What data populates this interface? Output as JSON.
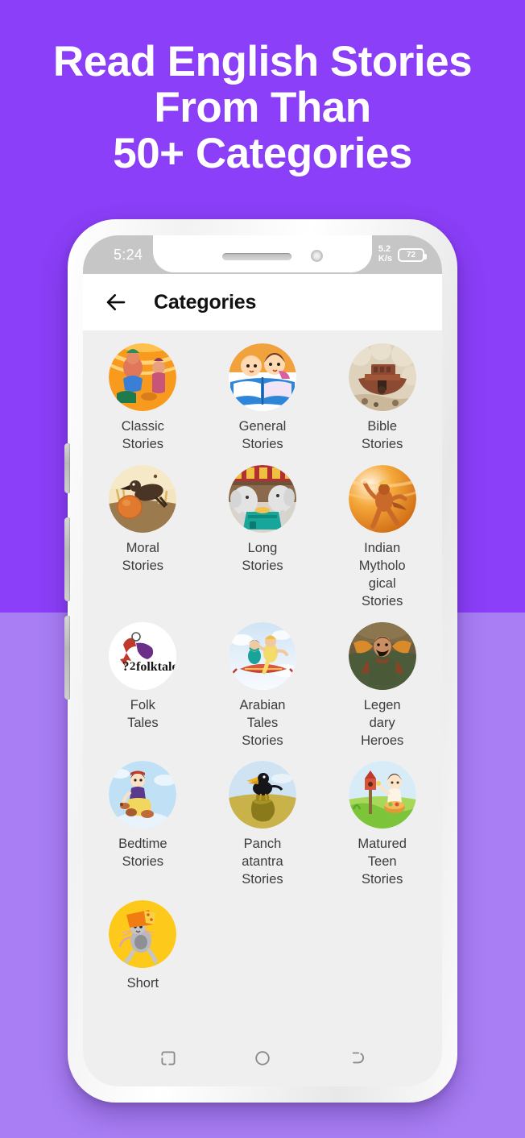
{
  "promo": {
    "line1": "Read English Stories",
    "line2": "From Than",
    "line3": "50+ Categories",
    "bg_color": "#8b3ff8",
    "bg_color_bottom": "#a97ef5",
    "text_color": "#ffffff"
  },
  "statusbar": {
    "time": "5:24",
    "airplane_icon": "airplane-icon",
    "network_speed_value": "5.2",
    "network_speed_unit": "K/s",
    "battery_percent": "72"
  },
  "appbar": {
    "back_icon": "back-arrow-icon",
    "title": "Categories"
  },
  "grid": {
    "background": "#efefef",
    "categories": [
      {
        "label": "Classic\nStories",
        "icon": "classic-stories-icon"
      },
      {
        "label": "General\nStories",
        "icon": "general-stories-icon"
      },
      {
        "label": "Bible\nStories",
        "icon": "bible-stories-icon"
      },
      {
        "label": "Moral\nStories",
        "icon": "moral-stories-icon"
      },
      {
        "label": "Long\nStories",
        "icon": "long-stories-icon"
      },
      {
        "label": "Indian\nMytholo\ngical\nStories",
        "icon": "indian-mythological-stories-icon"
      },
      {
        "label": "Folk\nTales",
        "icon": "folk-tales-icon"
      },
      {
        "label": "Arabian\nTales\nStories",
        "icon": "arabian-tales-stories-icon"
      },
      {
        "label": "Legen\ndary\nHeroes",
        "icon": "legendary-heroes-icon"
      },
      {
        "label": "Bedtime\nStories",
        "icon": "bedtime-stories-icon"
      },
      {
        "label": "Panch\natantra\nStories",
        "icon": "panchatantra-stories-icon"
      },
      {
        "label": "Matured\nTeen\nStories",
        "icon": "matured-teen-stories-icon"
      },
      {
        "label": "Short",
        "icon": "short-stories-icon"
      }
    ]
  },
  "navbar": {
    "recents_label": "recents-icon",
    "home_label": "home-icon",
    "back_label": "back-icon"
  }
}
